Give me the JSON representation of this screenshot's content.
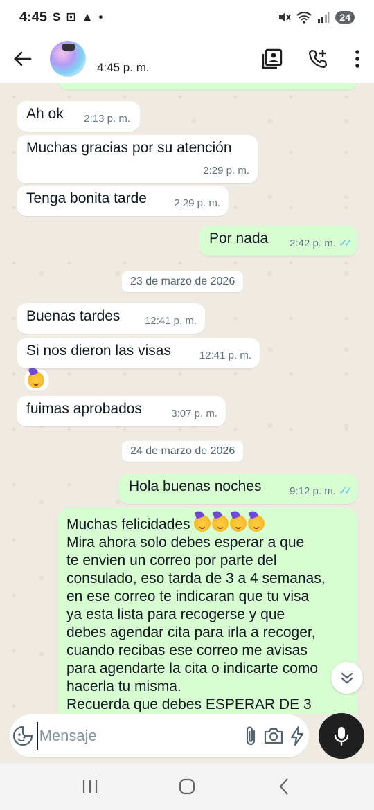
{
  "status_bar": {
    "time": "4:45",
    "left_icons": [
      "S",
      "⊡",
      "▲",
      "•"
    ],
    "battery": "24"
  },
  "header": {
    "subtitle": "4:45 p. m."
  },
  "messages": [
    {
      "type": "in",
      "text": "Ah ok",
      "time": "2:13 p. m."
    },
    {
      "type": "in",
      "text": "Muchas gracias por su atención",
      "time": "2:29 p. m."
    },
    {
      "type": "in",
      "text": "Tenga bonita tarde",
      "time": "2:29 p. m."
    },
    {
      "type": "out",
      "text": "Por nada",
      "time": "2:42 p. m."
    },
    {
      "type": "date",
      "text": "23 de marzo de 2026"
    },
    {
      "type": "in",
      "text": "Buenas tardes",
      "time": "12:41 p. m."
    },
    {
      "type": "in",
      "text": "Si nos dieron las visas",
      "time": "12:41 p. m."
    },
    {
      "type": "in",
      "text": "fuimas aprobados",
      "time": "3:07 p. m."
    },
    {
      "type": "date",
      "text": "24 de marzo de 2026"
    },
    {
      "type": "out",
      "text": "Hola buenas noches",
      "time": "9:12 p. m."
    },
    {
      "type": "out",
      "lines": [
        "Muchas felicidades",
        "Mira ahora solo debes esperar a que",
        "te envien un correo por parte del",
        "consulado, eso tarda de 3 a 4 semanas,",
        "en ese correo te indicaran que tu visa",
        "ya esta lista para recogerse y que",
        "debes agendar cita para irla a recoger,",
        "cuando recibas ese correo me avisas",
        "para agendarte la cita o indicarte como",
        "hacerla tu misma.",
        "Recuerda que debes ESPERAR DE 3"
      ]
    }
  ],
  "input": {
    "placeholder": "Mensaje"
  },
  "colors": {
    "chat_bg": "#efeae2",
    "incoming": "#ffffff",
    "outgoing": "#d9fdd3",
    "read_ticks": "#53bdeb"
  },
  "icons": {
    "back": "arrow-left",
    "contacts": "contact-card",
    "call": "phone-add",
    "menu": "more-vertical",
    "sticker": "sticker-smile",
    "attach": "paperclip",
    "camera": "camera",
    "quick": "lightning",
    "mic": "microphone",
    "scroll": "double-chevron-down"
  }
}
